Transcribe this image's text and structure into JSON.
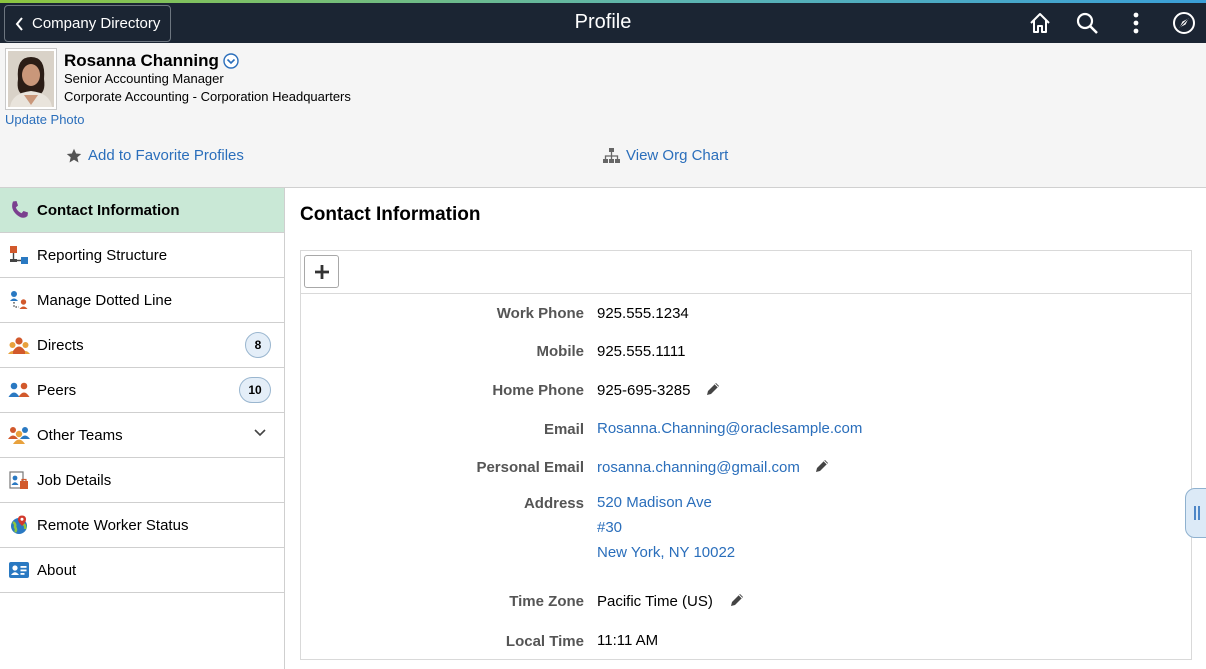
{
  "topbar": {
    "back_label": "Company Directory",
    "title": "Profile",
    "icons": [
      "home-icon",
      "search-icon",
      "more-icon",
      "navbar-icon"
    ]
  },
  "profile": {
    "name": "Rosanna Channing",
    "title": "Senior Accounting Manager",
    "department": "Corporate Accounting - Corporation Headquarters",
    "update_photo": "Update Photo",
    "add_favorite": "Add to Favorite Profiles",
    "view_org_chart": "View Org Chart"
  },
  "sidebar": {
    "items": [
      {
        "label": "Contact Information",
        "icon": "phone-icon",
        "active": true
      },
      {
        "label": "Reporting Structure",
        "icon": "reporting-icon"
      },
      {
        "label": "Manage Dotted Line",
        "icon": "dotted-line-icon"
      },
      {
        "label": "Directs",
        "icon": "directs-icon",
        "badge": "8"
      },
      {
        "label": "Peers",
        "icon": "peers-icon",
        "badge": "10"
      },
      {
        "label": "Other Teams",
        "icon": "teams-icon",
        "expandable": true
      },
      {
        "label": "Job Details",
        "icon": "job-details-icon"
      },
      {
        "label": "Remote Worker Status",
        "icon": "globe-pin-icon"
      },
      {
        "label": "About",
        "icon": "about-card-icon"
      }
    ]
  },
  "main": {
    "section_title": "Contact Information",
    "fields": {
      "work_phone": {
        "label": "Work Phone",
        "value": "925.555.1234"
      },
      "mobile": {
        "label": "Mobile",
        "value": "925.555.1111"
      },
      "home_phone": {
        "label": "Home Phone",
        "value": "925-695-3285"
      },
      "email": {
        "label": "Email",
        "value": "Rosanna.Channing@oraclesample.com"
      },
      "personal_email": {
        "label": "Personal Email",
        "value": "rosanna.channing@gmail.com"
      },
      "address": {
        "label": "Address",
        "line1": "520 Madison Ave",
        "line2": "#30",
        "line3": "New York, NY 10022"
      },
      "time_zone": {
        "label": "Time Zone",
        "value": "Pacific Time (US)"
      },
      "local_time": {
        "label": "Local Time",
        "value": "11:11 AM"
      }
    }
  },
  "colors": {
    "topbar": "#1b2533",
    "link": "#2a6ebb",
    "active_nav": "#c9e8d6"
  }
}
